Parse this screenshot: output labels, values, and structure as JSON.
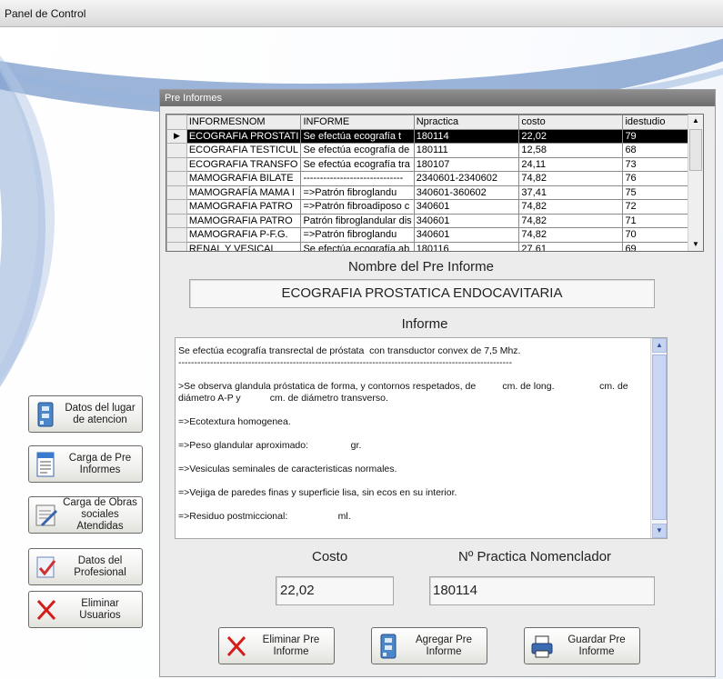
{
  "window": {
    "title": "Panel de Control"
  },
  "panel": {
    "title": "Pre Informes"
  },
  "grid": {
    "columns": [
      "INFORMESNOM",
      "INFORME",
      "Npractica",
      "costo",
      "idestudio"
    ],
    "rows": [
      [
        "ECOGRAFIA PROSTATI",
        "Se efectúa ecografía t",
        "180114",
        "22,02",
        "79"
      ],
      [
        "ECOGRAFIA TESTICUL",
        "Se efectúa ecografía de",
        "180111",
        "12,58",
        "68"
      ],
      [
        "ECOGRAFIA TRANSFO",
        "Se efectúa ecografía tra",
        "180107",
        "24,11",
        "73"
      ],
      [
        "MAMOGRAFIA BILATE",
        "------------------------------",
        "2340601-2340602",
        "74,82",
        "76"
      ],
      [
        "MAMOGRAFÍA MAMA I",
        "=>Patrón fibroglandu",
        "340601-360602",
        "37,41",
        "75"
      ],
      [
        "MAMOGRAFIA PATRO",
        "=>Patrón fibroadiposo c",
        "340601",
        "74,82",
        "72"
      ],
      [
        "MAMOGRAFIA PATRO",
        "Patrón fibroglandular dis",
        "340601",
        "74,82",
        "71"
      ],
      [
        "MAMOGRAFIA P-F.G.",
        "=>Patrón fibroglandu",
        "340601",
        "74,82",
        "70"
      ],
      [
        "RENAL Y VESICAL",
        "Se efectúa ecografía ab",
        "180116",
        "27,61",
        "69"
      ]
    ]
  },
  "form": {
    "nombre_label": "Nombre del Pre Informe",
    "nombre_value": "ECOGRAFIA PROSTATICA ENDOCAVITARIA",
    "informe_label": "Informe",
    "informe_lines": [
      "Se efectúa ecografía transrectal de próstata  con transductor convex de 7,5 Mhz.\n---------------------------------------------------------------------------------------------------------",
      ">Se observa glandula próstatica de forma, y contornos respetados, de          cm. de long.                 cm. de diámetro A-P y           cm. de diámetro transverso.",
      "=>Ecotextura homogenea.",
      "=>Peso glandular aproximado:                gr.",
      "=>Vesiculas seminales de caracteristicas normales.",
      "=>Vejiga de paredes finas y superficie lisa, sin ecos en su interior.",
      "=>Residuo postmiccional:                   ml."
    ],
    "costo_label": "Costo",
    "costo_value": "22,02",
    "practica_label": "Nº Practica Nomenclador",
    "practica_value": "180114"
  },
  "sidebar": {
    "datos_lugar": "Datos del lugar de atencion",
    "carga_pre": "Carga de Pre Informes",
    "carga_obras": "Carga de Obras sociales Atendidas",
    "datos_prof": "Datos del Profesional",
    "eliminar_usuarios": "Eliminar Usuarios"
  },
  "actions": {
    "eliminar": "Eliminar Pre Informe",
    "agregar": "Agregar Pre Informe",
    "guardar": "Guardar Pre Informe"
  },
  "colors": {
    "accent": "#4a76b8",
    "selected_row": "#000000",
    "memo_scroll": "#c6d4f0"
  }
}
